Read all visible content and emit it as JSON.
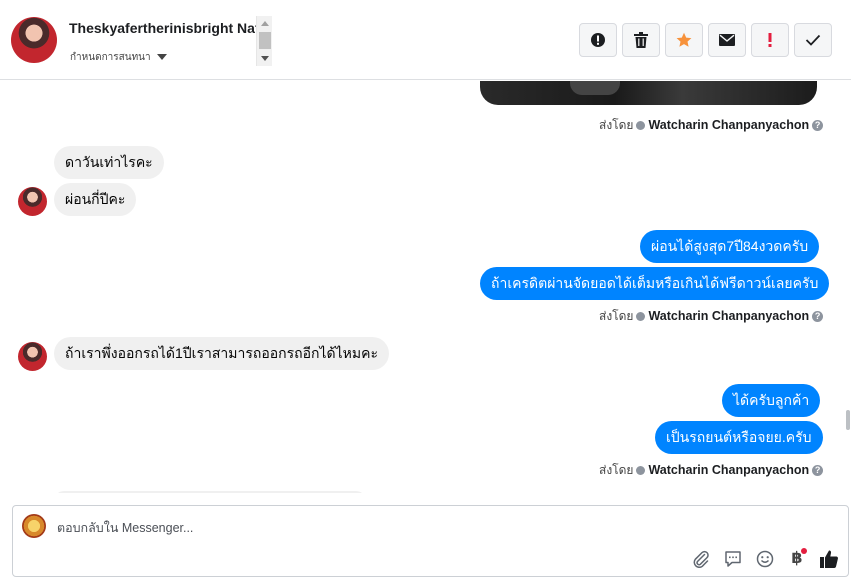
{
  "header": {
    "contact_name": "Theskyafertherinisbright Nat",
    "subtitle": "กำหนดการสนทนา",
    "actions": [
      {
        "name": "report-spam-button",
        "icon": "alert-circle-icon"
      },
      {
        "name": "delete-button",
        "icon": "trash-icon"
      },
      {
        "name": "star-button",
        "icon": "star-icon",
        "color": "#f7923b"
      },
      {
        "name": "mark-unread-button",
        "icon": "envelope-icon"
      },
      {
        "name": "priority-button",
        "icon": "exclamation-icon",
        "color": "#e41e3f"
      },
      {
        "name": "mark-done-button",
        "icon": "checkmark-icon"
      }
    ]
  },
  "messages": {
    "sent_by_prefix": "ส่งโดย",
    "sender_name": "Watcharin Chanpanyachon",
    "help_glyph": "?",
    "items": [
      {
        "id": "m1",
        "direction": "in",
        "text": "ดาวันเท่าไรคะ"
      },
      {
        "id": "m2",
        "direction": "in",
        "text": "ผ่อนกี่ปีคะ"
      },
      {
        "id": "m3",
        "direction": "out",
        "text": "ผ่อนได้สูงสุด7ปี84งวดครับ"
      },
      {
        "id": "m4",
        "direction": "out",
        "text": "ถ้าเครดิตผ่านจัดยอดได้เต็มหรือเกินได้ฟรีดาวน์เลยครับ"
      },
      {
        "id": "m5",
        "direction": "in",
        "text": "ถ้าเราพึ่งออกรถได้1ปีเราสามารถออกรถอีกได้ไหมคะ"
      },
      {
        "id": "m6",
        "direction": "out",
        "text": "ได้ครับลูกค้า"
      },
      {
        "id": "m7",
        "direction": "out",
        "text": "เป็นรถยนต์หรือจยย.ครับ"
      }
    ]
  },
  "composer": {
    "placeholder": "ตอบกลับใน Messenger...",
    "currency_symbol": "฿",
    "icons": [
      "paperclip-icon",
      "saved-replies-icon",
      "emoji-icon",
      "payment-baht-icon",
      "thumbs-up-icon"
    ]
  },
  "colors": {
    "outgoing_bubble": "#0084ff",
    "incoming_bubble": "#f0f0f0",
    "star": "#f7923b",
    "alert": "#e41e3f"
  }
}
